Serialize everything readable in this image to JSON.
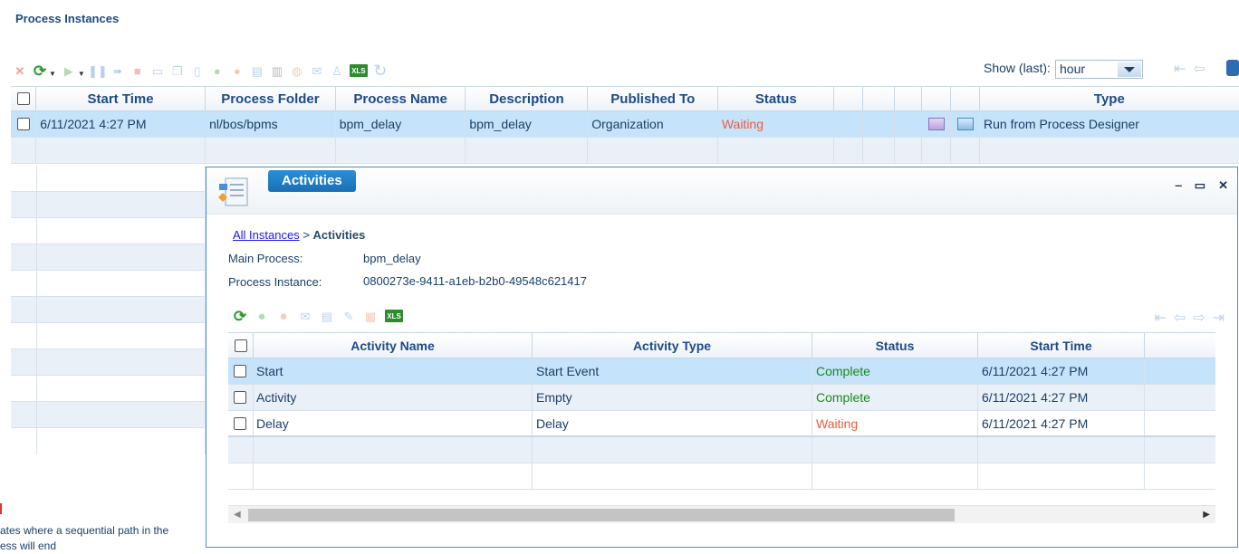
{
  "page": {
    "title": "Process Instances"
  },
  "toolbar": {
    "show_last_label": "Show (last):",
    "show_last_value": "hour",
    "xls_label": "XLS",
    "icons": [
      "delete-icon",
      "refresh-icon",
      "play-icon",
      "pause-icon",
      "resume-icon",
      "stop-icon",
      "message-icon",
      "copy-icon",
      "document-icon",
      "complete-icon",
      "abort-icon",
      "list-icon",
      "barcode-icon",
      "comment-icon",
      "mail-icon",
      "hierarchy-icon",
      "xls-icon",
      "reload-icon"
    ]
  },
  "main_grid": {
    "columns": [
      "Start Time",
      "Process Folder",
      "Process Name",
      "Description",
      "Published To",
      "Status",
      "Type"
    ],
    "rows": [
      {
        "start_time": "6/11/2021 4:27 PM",
        "process_folder": "nl/bos/bpms",
        "process_name": "bpm_delay",
        "description": "bpm_delay",
        "published_to": "Organization",
        "status": "Waiting",
        "type": "Run from Process Designer"
      }
    ]
  },
  "bottom_note": "ates where a sequential path in the\ness will end",
  "dialog": {
    "title": "Activities",
    "breadcrumb": {
      "link": "All Instances",
      "separator": " > ",
      "current": "Activities"
    },
    "main_process_label": "Main Process:",
    "main_process_value": "bpm_delay",
    "process_instance_label": "Process Instance:",
    "process_instance_value": "0800273e-9411-a1eb-b2b0-49548c621417",
    "xls_label": "XLS",
    "columns": [
      "Activity Name",
      "Activity Type",
      "Status",
      "Start Time"
    ],
    "rows": [
      {
        "name": "Start",
        "type": "Start Event",
        "status": "Complete",
        "start_time": "6/11/2021 4:27 PM"
      },
      {
        "name": "Activity",
        "type": "Empty",
        "status": "Complete",
        "start_time": "6/11/2021 4:27 PM"
      },
      {
        "name": "Delay",
        "type": "Delay",
        "status": "Waiting",
        "start_time": "6/11/2021 4:27 PM"
      }
    ]
  },
  "colors": {
    "accent": "#1a6fb5",
    "selected_row": "#c5e3fb",
    "waiting": "#f05a3c",
    "complete": "#1a8a1a"
  }
}
